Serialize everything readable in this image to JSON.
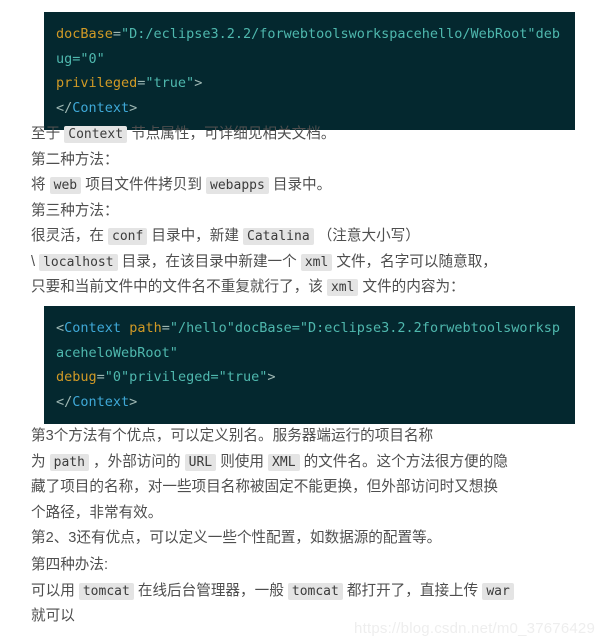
{
  "code_blocks": [
    {
      "id": "code-1",
      "lines": [
        [
          {
            "t": "attr",
            "s": "docBase"
          },
          {
            "t": "punct",
            "s": "="
          },
          {
            "t": "val",
            "s": "\"D:/eclipse3.2.2/forwebtoolsworkspacehello/WebRoot\""
          },
          {
            "t": "val",
            "s": "deb"
          }
        ],
        [
          {
            "t": "val",
            "s": "ug=\"0\""
          }
        ],
        [
          {
            "t": "attr",
            "s": "privileged"
          },
          {
            "t": "punct",
            "s": "="
          },
          {
            "t": "val",
            "s": "\"true\""
          },
          {
            "t": "punct",
            "s": ">"
          }
        ],
        [
          {
            "t": "punct",
            "s": "</"
          },
          {
            "t": "tag",
            "s": "Context"
          },
          {
            "t": "punct",
            "s": ">"
          }
        ]
      ]
    },
    {
      "id": "code-2",
      "lines": [
        [
          {
            "t": "punct",
            "s": "<"
          },
          {
            "t": "tag",
            "s": "Context"
          },
          {
            "t": "plain",
            "s": " "
          },
          {
            "t": "attr",
            "s": "path"
          },
          {
            "t": "punct",
            "s": "="
          },
          {
            "t": "val",
            "s": "\"/hello\""
          },
          {
            "t": "val",
            "s": "docBase=\"D:eclipse3.2.2forwebtoolsworksp"
          }
        ],
        [
          {
            "t": "val",
            "s": "aceheloWebRoot\""
          }
        ],
        [
          {
            "t": "attr",
            "s": "debug"
          },
          {
            "t": "punct",
            "s": "="
          },
          {
            "t": "val",
            "s": "\"0\""
          },
          {
            "t": "val",
            "s": "privileged=\"true\""
          },
          {
            "t": "punct",
            "s": ">"
          }
        ],
        [
          {
            "t": "punct",
            "s": "</"
          },
          {
            "t": "tag",
            "s": "Context"
          },
          {
            "t": "punct",
            "s": ">"
          }
        ]
      ]
    }
  ],
  "prose_1": [
    [
      {
        "t": "text",
        "s": "至于 "
      },
      {
        "t": "code",
        "s": "Context"
      },
      {
        "t": "text",
        "s": " 节点属性，可详细见相关文档。"
      }
    ],
    [
      {
        "t": "text",
        "s": "第二种方法："
      }
    ],
    [
      {
        "t": "text",
        "s": "将 "
      },
      {
        "t": "code",
        "s": "web"
      },
      {
        "t": "text",
        "s": " 项目文件件拷贝到 "
      },
      {
        "t": "code",
        "s": "webapps"
      },
      {
        "t": "text",
        "s": " 目录中。"
      }
    ],
    [
      {
        "t": "text",
        "s": "第三种方法："
      }
    ],
    [
      {
        "t": "text",
        "s": "很灵活，在 "
      },
      {
        "t": "code",
        "s": "conf"
      },
      {
        "t": "text",
        "s": " 目录中，新建 "
      },
      {
        "t": "code",
        "s": "Catalina"
      },
      {
        "t": "text",
        "s": " （注意大小写）"
      }
    ],
    [
      {
        "t": "text",
        "s": "\\ "
      },
      {
        "t": "code",
        "s": "localhost"
      },
      {
        "t": "text",
        "s": " 目录，在该目录中新建一个 "
      },
      {
        "t": "code",
        "s": "xml"
      },
      {
        "t": "text",
        "s": " 文件，名字可以随意取，"
      }
    ],
    [
      {
        "t": "text",
        "s": "只要和当前文件中的文件名不重复就行了，该 "
      },
      {
        "t": "code",
        "s": "xml"
      },
      {
        "t": "text",
        "s": " 文件的内容为："
      }
    ]
  ],
  "prose_2": [
    [
      {
        "t": "text",
        "s": "第3个方法有个优点，可以定义别名。服务器端运行的项目名称"
      }
    ],
    [
      {
        "t": "text",
        "s": "为 "
      },
      {
        "t": "code",
        "s": "path"
      },
      {
        "t": "text",
        "s": " ，外部访问的 "
      },
      {
        "t": "code",
        "s": "URL"
      },
      {
        "t": "text",
        "s": " 则使用 "
      },
      {
        "t": "code",
        "s": "XML"
      },
      {
        "t": "text",
        "s": " 的文件名。这个方法很方便的隐"
      }
    ],
    [
      {
        "t": "text",
        "s": "藏了项目的名称，对一些项目名称被固定不能更换，但外部访问时又想换"
      }
    ],
    [
      {
        "t": "text",
        "s": "个路径，非常有效。"
      }
    ],
    [
      {
        "t": "text",
        "s": "第2、3还有优点，可以定义一些个性配置，如数据源的配置等。"
      }
    ]
  ],
  "prose_3": [
    [
      {
        "t": "text",
        "s": "第四种办法:"
      }
    ],
    [
      {
        "t": "text",
        "s": "可以用 "
      },
      {
        "t": "code",
        "s": "tomcat"
      },
      {
        "t": "text",
        "s": " 在线后台管理器，一般 "
      },
      {
        "t": "code",
        "s": "tomcat"
      },
      {
        "t": "text",
        "s": " 都打开了，直接上传 "
      },
      {
        "t": "code",
        "s": "war"
      }
    ],
    [
      {
        "t": "text",
        "s": "就可以"
      }
    ]
  ],
  "watermark": {
    "url": "https://blog.csdn.net/m0_37676429"
  },
  "colors": {
    "code_background": "#04282f",
    "code_attribute": "#d19a26",
    "code_value": "#4fb8ae",
    "code_tag": "#3fa9d8",
    "inline_code_background": "#e4e4e4",
    "body_text": "#4e4e4e",
    "page_background": "#ffffff"
  }
}
